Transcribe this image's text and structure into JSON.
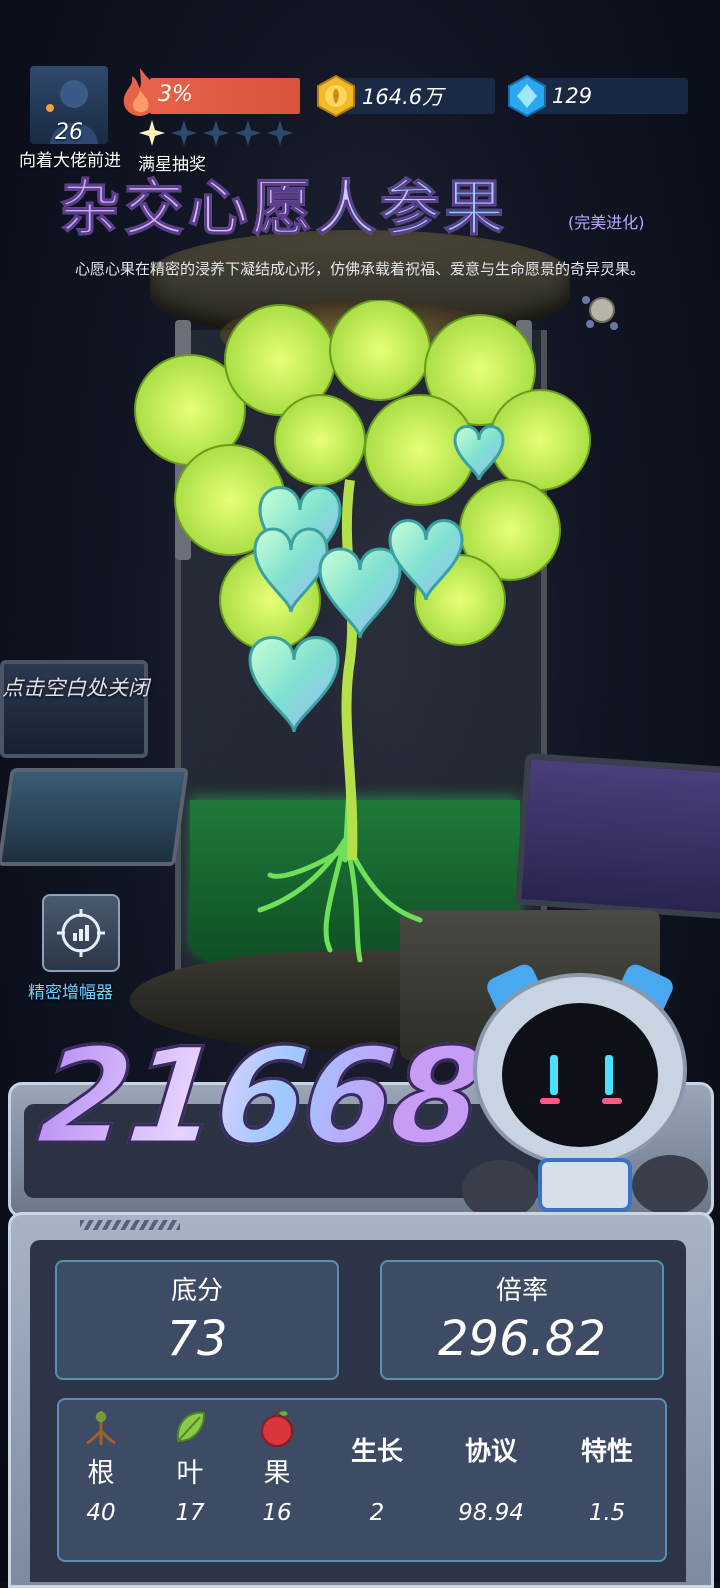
{
  "player": {
    "level": "26",
    "caption": "向着大佬前进"
  },
  "progress": {
    "label": "3%",
    "percent": 3,
    "stars_filled": 1,
    "stars_total": 5,
    "stars_caption": "满星抽奖"
  },
  "currency": {
    "gold": "164.6万",
    "gems": "129"
  },
  "item": {
    "title": "杂交心愿人参果",
    "tag": "(完美进化)",
    "description": "心愿心果在精密的浸养下凝结成心形，仿佛承载着祝福、爱意与生命愿景的奇异灵果。"
  },
  "controls": {
    "close_hint": "点击空白处关闭",
    "amplifier_label": "精密增幅器"
  },
  "score": {
    "total": "21668",
    "base_label": "底分",
    "base_value": "73",
    "multiplier_label": "倍率",
    "multiplier_value": "296.82"
  },
  "attributes": [
    {
      "name": "根",
      "value": "40",
      "icon": "root-icon"
    },
    {
      "name": "叶",
      "value": "17",
      "icon": "leaf-icon"
    },
    {
      "name": "果",
      "value": "16",
      "icon": "apple-icon"
    },
    {
      "name": "生长",
      "value": "2"
    },
    {
      "name": "协议",
      "value": "98.94"
    },
    {
      "name": "特性",
      "value": "1.5"
    }
  ],
  "colors": {
    "fire_bar": "#e8624a",
    "title_gradient_start": "#c9a6f5",
    "amplifier_text": "#6fd0ff",
    "panel_bg": "#3d4b64",
    "panel_border": "#5a8fb0"
  }
}
